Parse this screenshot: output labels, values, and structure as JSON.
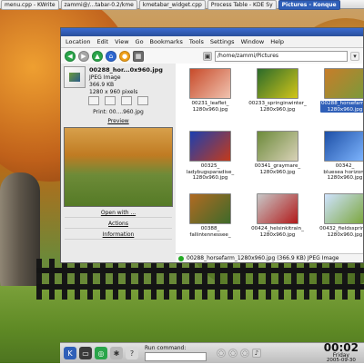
{
  "taskbar": {
    "tasks": [
      {
        "label": "menu.cpp - KWrite",
        "active": false
      },
      {
        "label": "zammi@/...tabar-0.2/kme",
        "active": false
      },
      {
        "label": "kmetabar_widget.cpp",
        "active": false
      },
      {
        "label": "Process Table - KDE Sy",
        "active": false
      },
      {
        "label": "Pictures - Konque",
        "active": true
      }
    ]
  },
  "window": {
    "menu": [
      "Location",
      "Edit",
      "View",
      "Go",
      "Bookmarks",
      "Tools",
      "Settings",
      "Window",
      "Help"
    ],
    "toolbar": {
      "back_icon": "back-arrow-icon",
      "forward_icon": "forward-arrow-icon",
      "up_icon": "up-arrow-icon",
      "home_icon": "home-icon",
      "stop_icon": "stop-icon",
      "view_icon": "icon-view-icon",
      "address": {
        "value": "/home/zammi/Pictures",
        "placeholder": ""
      }
    },
    "sidebar": {
      "file_name": "00288_hor...0x960.jpg",
      "file_type": "JPEG Image",
      "file_size": "366.9 KB",
      "dimensions": "1280 x 960 pixels",
      "print_label": "Print: 00....960.jpg",
      "preview_label": "Preview",
      "links": [
        "Open with ...",
        "Actions",
        "Information"
      ]
    },
    "files": [
      {
        "label": "00231_leaflet_\n1280x960.jpg",
        "thumb_colors": [
          "#c84b2a",
          "#f0c3b0"
        ],
        "selected": false
      },
      {
        "label": "00233_springinwinter_\n1280x960.jpg",
        "thumb_colors": [
          "#2b6b2a",
          "#d2c51a"
        ],
        "selected": false
      },
      {
        "label": "00288_horsefarm_\n1280x960.jpg",
        "thumb_colors": [
          "#c77d2a",
          "#7a9a3a"
        ],
        "selected": true
      },
      {
        "label": "00325_\nladybugsparadise_\n1280x960.jpg",
        "thumb_colors": [
          "#1c3fb0",
          "#c43a1a"
        ],
        "selected": false
      },
      {
        "label": "00341_graymare_\n1280x960.jpg",
        "thumb_colors": [
          "#6c8a3a",
          "#d9d2b8"
        ],
        "selected": false
      },
      {
        "label": "00342_\nbluesea horizon_\n1280x960.jpg",
        "thumb_colors": [
          "#1d4fa6",
          "#7fb6ff"
        ],
        "selected": false
      },
      {
        "label": "00388_\nfallintennessee_",
        "thumb_colors": [
          "#b06a22",
          "#3e6a2a"
        ],
        "selected": false
      },
      {
        "label": "00424_helsinkitrain_\n1280x960.jpg",
        "thumb_colors": [
          "#c7c7c7",
          "#b21a1a"
        ],
        "selected": false
      },
      {
        "label": "00432_fieldsspring_\n1280x960.jpg",
        "thumb_colors": [
          "#cfe3ff",
          "#7aa53a"
        ],
        "selected": false
      }
    ],
    "status": "00288_horsefarm_1280x960.jpg (366.9 KB) JPEG Image"
  },
  "panel": {
    "run_label": "Run command:",
    "run_value": "",
    "clock_time": "00:02",
    "clock_day": "Friday",
    "clock_date": "2005-09-30"
  }
}
